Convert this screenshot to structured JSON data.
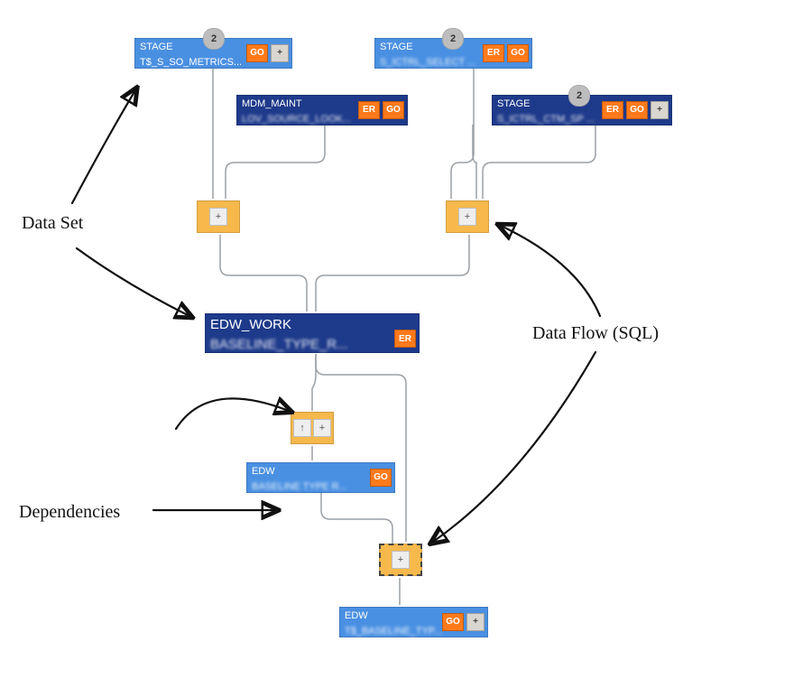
{
  "nodes": {
    "n1": {
      "line1": "STAGE",
      "line2": "T$_S_SO_METRICS...",
      "count": "2",
      "badges": [
        "GO",
        "+"
      ]
    },
    "n2": {
      "line1": "STAGE",
      "line2": "S_ICTRL_SELECT ...",
      "count": "2",
      "badges": [
        "ER",
        "GO"
      ]
    },
    "n3": {
      "line1": "MDM_MAINT",
      "line2": "LOV_SOURCE_LOOK...",
      "badges": [
        "ER",
        "GO"
      ]
    },
    "n4": {
      "line1": "STAGE",
      "line2": "S_ICTRL_CTM_SP ...",
      "count": "2",
      "badges": [
        "ER",
        "GO",
        "+"
      ]
    },
    "n5": {
      "line1": "EDW_WORK",
      "line2": "BASELINE_TYPE_R...",
      "badges": [
        "ER"
      ]
    },
    "n6": {
      "line1": "EDW",
      "line2": "BASELINE TYPE R...",
      "badges": [
        "GO"
      ]
    },
    "n7": {
      "line1": "EDW",
      "line2": "T$_BASELINE_TYP...",
      "badges": [
        "GO",
        "+"
      ]
    }
  },
  "joins": {
    "j1": {
      "minis": [
        "+"
      ]
    },
    "j2": {
      "minis": [
        "+"
      ]
    },
    "j3": {
      "minis": [
        "↑",
        "+"
      ]
    },
    "j4": {
      "minis": [
        "+"
      ],
      "selected": true
    }
  },
  "annotations": {
    "dataset": "Data Set",
    "dataflow": "Data Flow (SQL)",
    "deps": "Dependencies"
  }
}
